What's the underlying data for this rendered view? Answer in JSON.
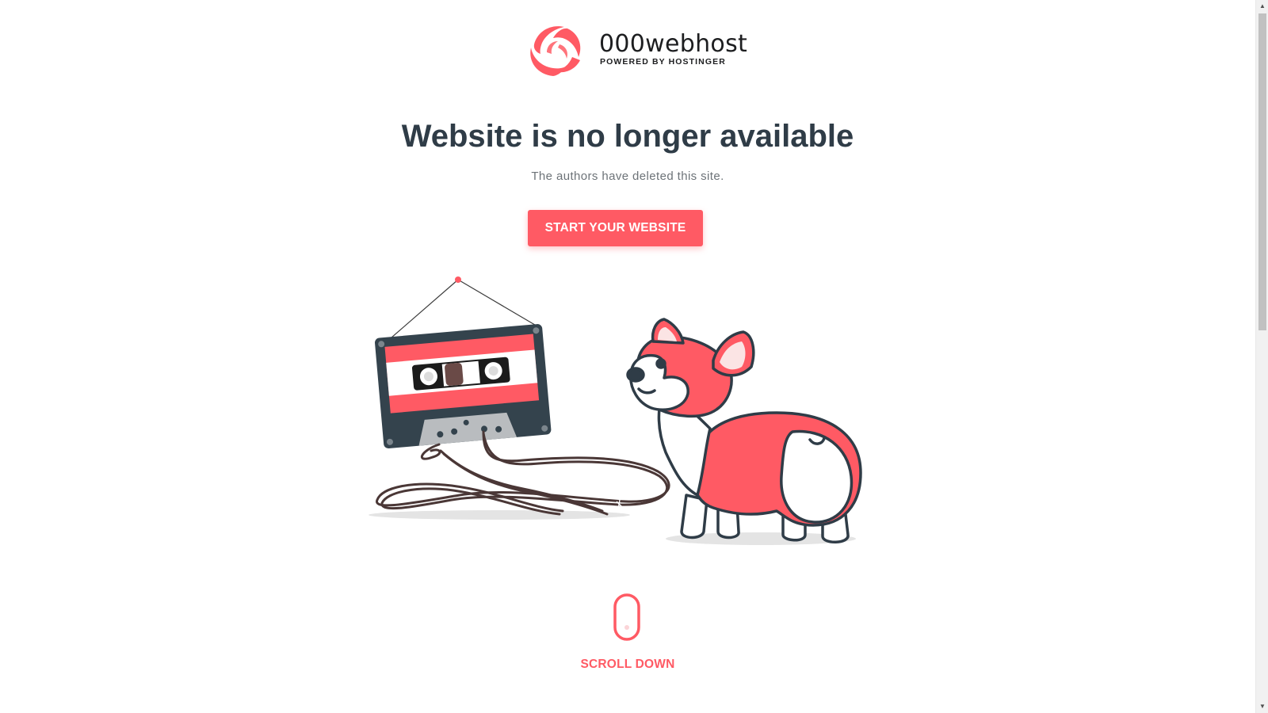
{
  "logo": {
    "name": "000webhost",
    "tagline": "POWERED BY HOSTINGER"
  },
  "main": {
    "title": "Website is no longer available",
    "subtitle": "The authors have deleted this site.",
    "cta_label": "START YOUR WEBSITE"
  },
  "footer": {
    "scroll_label": "SCROLL DOWN"
  },
  "illustration": {
    "description_icons": [
      "cassette-tape-icon",
      "corgi-dog-icon"
    ]
  },
  "colors": {
    "brand": "#ff5a64",
    "heading": "#2f3c47",
    "text_muted": "#6d7378",
    "outline": "#2f3c47",
    "tape": "#4a3736"
  }
}
